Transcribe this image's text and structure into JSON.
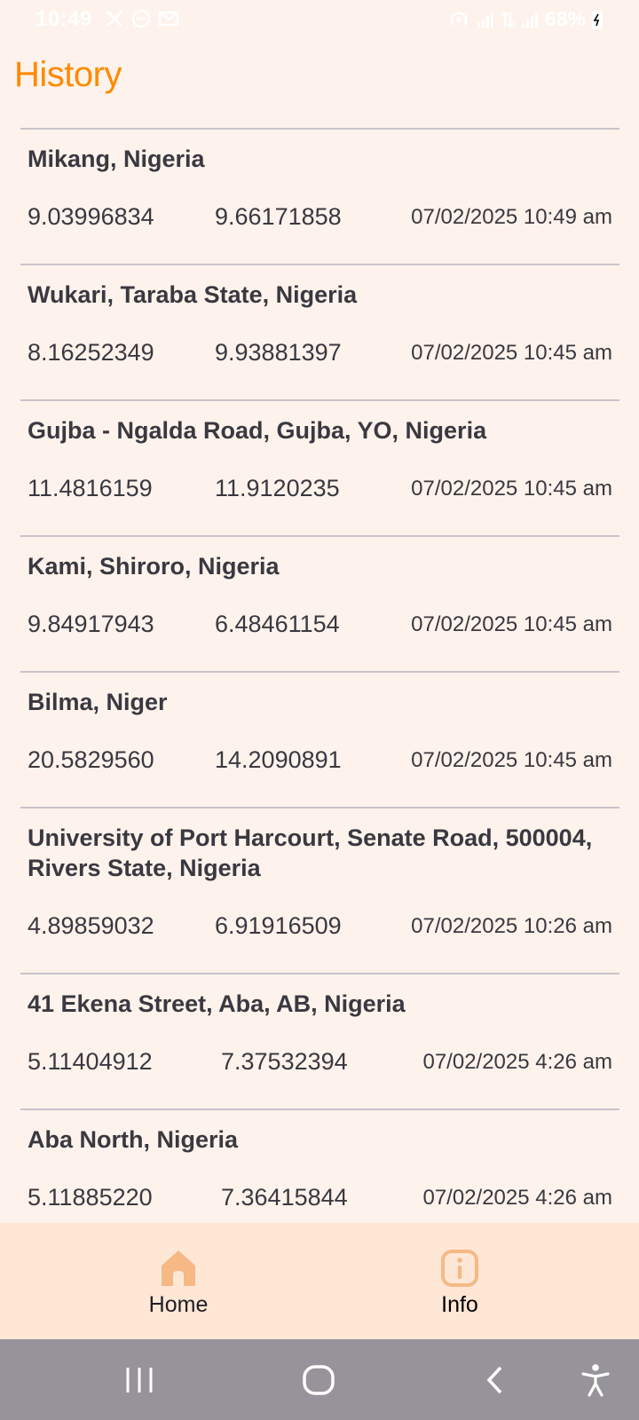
{
  "status_bar": {
    "time": "10:49",
    "battery": "68%",
    "left_icons": [
      "tools-icon",
      "minus-circle-icon",
      "mail-icon"
    ],
    "right_icons": [
      "hotspot-icon",
      "signal-1-icon",
      "data-arrows-icon",
      "signal-2-icon",
      "battery-icon"
    ]
  },
  "page": {
    "title": "History"
  },
  "history": [
    {
      "name": "Mikang, Nigeria",
      "lat": "9.03996834",
      "lng": "9.66171858",
      "datetime": "07/02/2025 10:49 am"
    },
    {
      "name": "Wukari, Taraba State, Nigeria",
      "lat": "8.16252349",
      "lng": "9.93881397",
      "datetime": "07/02/2025 10:45 am"
    },
    {
      "name": "Gujba - Ngalda Road, Gujba, YO, Nigeria",
      "lat": "11.4816159",
      "lng": "11.9120235",
      "datetime": "07/02/2025 10:45 am"
    },
    {
      "name": "Kami, Shiroro, Nigeria",
      "lat": "9.84917943",
      "lng": "6.48461154",
      "datetime": "07/02/2025 10:45 am"
    },
    {
      "name": "Bilma, Niger",
      "lat": "20.5829560",
      "lng": "14.2090891",
      "datetime": "07/02/2025 10:45 am"
    },
    {
      "name": "University of Port Harcourt, Senate Road, 500004, Rivers State, Nigeria",
      "lat": "4.89859032",
      "lng": "6.91916509",
      "datetime": "07/02/2025 10:26 am"
    },
    {
      "name": "41 Ekena Street, Aba, AB, Nigeria",
      "lat": "5.11404912",
      "lng": "7.37532394",
      "datetime": "07/02/2025 4:26 am"
    },
    {
      "name": "Aba North, Nigeria",
      "lat": "5.11885220",
      "lng": "7.36415844",
      "datetime": "07/02/2025 4:26 am"
    }
  ],
  "bottom_nav": {
    "home_label": "Home",
    "info_label": "Info",
    "home_icon": "home-icon",
    "info_icon": "info-icon"
  },
  "system_nav": {
    "recents_icon": "recents-icon",
    "home_icon": "system-home-icon",
    "back_icon": "back-icon",
    "accessibility_icon": "accessibility-icon"
  },
  "colors": {
    "accent": "#FF8A00",
    "background": "#FDF3EC",
    "nav_background": "#FFE7D6",
    "icon_fill": "#F6B885",
    "text": "#3A3840",
    "system_bar": "#97939A"
  }
}
